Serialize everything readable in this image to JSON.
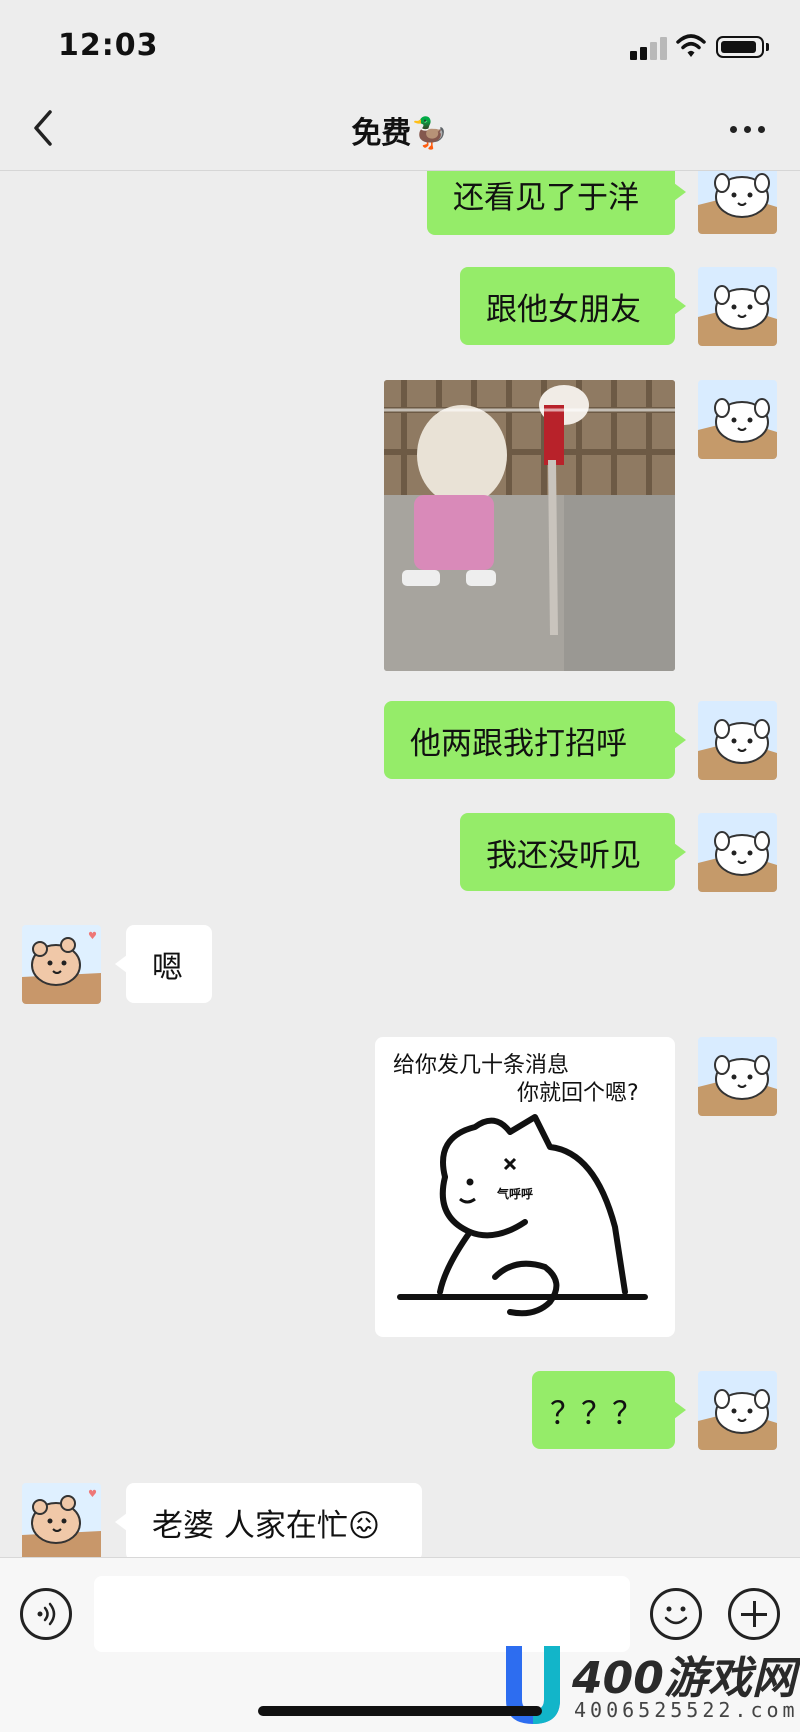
{
  "status_bar": {
    "time": "12:03"
  },
  "header": {
    "title": "免费🦆"
  },
  "messages": [
    {
      "sender": "me",
      "type": "text",
      "text": "还看见了于洋"
    },
    {
      "sender": "me",
      "type": "text",
      "text": "跟他女朋友"
    },
    {
      "sender": "me",
      "type": "image"
    },
    {
      "sender": "me",
      "type": "text",
      "text": "他两跟我打招呼"
    },
    {
      "sender": "me",
      "type": "text",
      "text": "我还没听见"
    },
    {
      "sender": "them",
      "type": "text",
      "text": "嗯"
    },
    {
      "sender": "me",
      "type": "sticker",
      "line1": "给你发几十条消息",
      "line2": "你就回个嗯?",
      "face_text": "气呼呼"
    },
    {
      "sender": "me",
      "type": "text",
      "text": "？？？"
    },
    {
      "sender": "them",
      "type": "text",
      "text": "老婆 人家在忙😖"
    }
  ],
  "input_bar": {
    "value": ""
  },
  "watermark": {
    "brand": "400游戏网",
    "phone": "4006525522.com"
  },
  "icons": {
    "back": "chevron-left-icon",
    "more": "more-dots-icon",
    "voice": "voice-icon",
    "emoji": "emoji-icon",
    "plus": "plus-icon"
  },
  "colors": {
    "background": "#ededed",
    "my_bubble": "#95ec69",
    "their_bubble": "#ffffff"
  }
}
